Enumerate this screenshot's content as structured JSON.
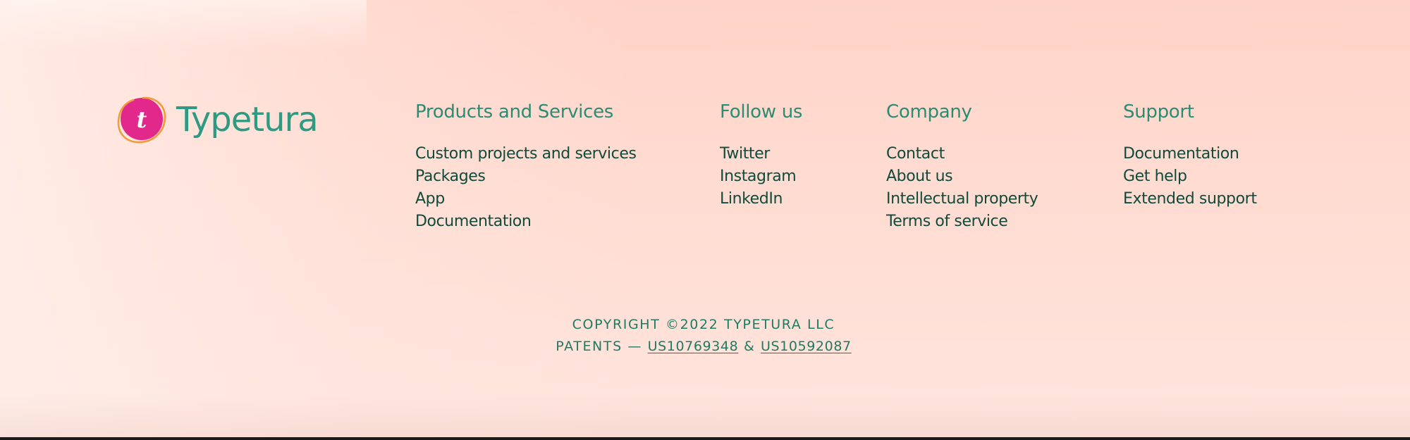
{
  "brand": {
    "name": "Typetura",
    "mark_letter": "t",
    "colors": {
      "mark_fill": "#e2288a",
      "mark_ring": "#f19a3e",
      "wordmark": "#2f9a82",
      "heading": "#2b8c72",
      "link": "#0f4a3b"
    }
  },
  "columns": [
    {
      "heading": "Products and Services",
      "items": [
        "Custom projects and services",
        "Packages",
        "App",
        "Documentation"
      ]
    },
    {
      "heading": "Follow us",
      "items": [
        "Twitter",
        "Instagram",
        "LinkedIn"
      ]
    },
    {
      "heading": "Company",
      "items": [
        "Contact",
        "About us",
        "Intellectual property",
        "Terms of service"
      ]
    },
    {
      "heading": "Support",
      "items": [
        "Documentation",
        "Get help",
        "Extended support"
      ]
    }
  ],
  "legal": {
    "copyright": "COPYRIGHT ©2022 TYPETURA LLC",
    "patents_prefix": "PATENTS — ",
    "patent_1": "US10769348",
    "patent_separator": " & ",
    "patent_2": "US10592087"
  }
}
